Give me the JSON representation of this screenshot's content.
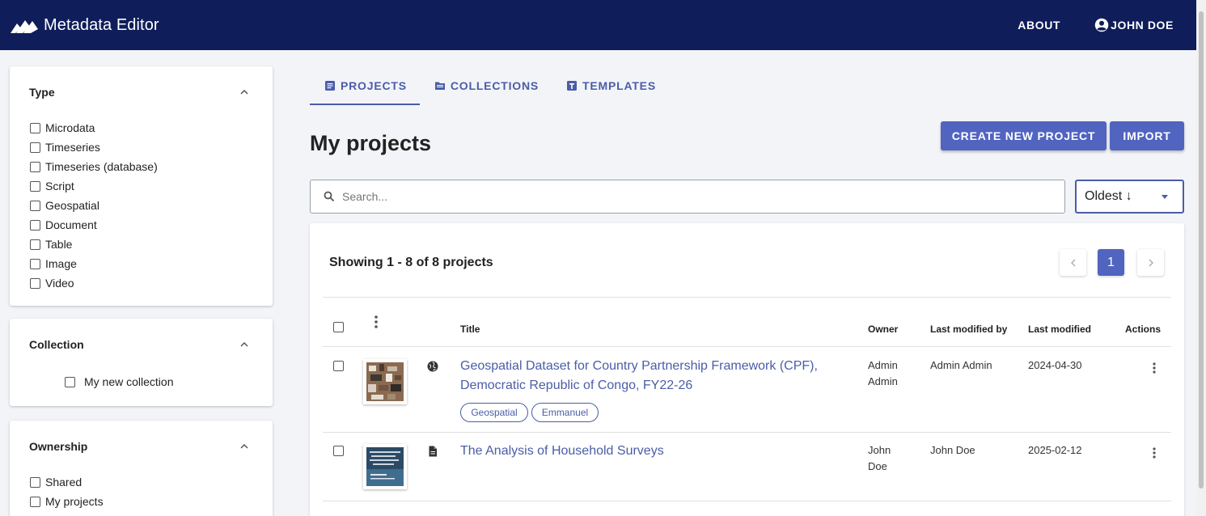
{
  "app": {
    "title": "Metadata Editor"
  },
  "header": {
    "about": "ABOUT",
    "user": "JOHN DOE"
  },
  "filters": {
    "type": {
      "title": "Type",
      "options": [
        "Microdata",
        "Timeseries",
        "Timeseries (database)",
        "Script",
        "Geospatial",
        "Document",
        "Table",
        "Image",
        "Video"
      ]
    },
    "collection": {
      "title": "Collection",
      "options": [
        "My new collection"
      ]
    },
    "ownership": {
      "title": "Ownership",
      "options": [
        "Shared",
        "My projects"
      ]
    }
  },
  "tabs": [
    {
      "label": "PROJECTS",
      "icon": "projects-icon",
      "active": true
    },
    {
      "label": "COLLECTIONS",
      "icon": "folder-icon",
      "active": false
    },
    {
      "label": "TEMPLATES",
      "icon": "template-icon",
      "active": false
    }
  ],
  "main": {
    "title": "My projects",
    "create_button": "CREATE NEW PROJECT",
    "import_button": "IMPORT",
    "search_placeholder": "Search...",
    "sort_value": "Oldest ↓",
    "showing": "Showing 1 - 8 of 8 projects",
    "current_page": "1"
  },
  "table": {
    "headers": {
      "title": "Title",
      "owner": "Owner",
      "modified_by": "Last modified by",
      "modified": "Last modified",
      "actions": "Actions"
    },
    "rows": [
      {
        "type_icon": "globe-icon",
        "title": "Geospatial Dataset for Country Partnership Framework (CPF), Democratic Republic of Congo, FY22-26",
        "owner": "Admin Admin",
        "modified_by": "Admin Admin",
        "modified": "2024-04-30",
        "tags": [
          "Geospatial",
          "Emmanuel"
        ]
      },
      {
        "type_icon": "document-icon",
        "title": "The Analysis of Household Surveys",
        "owner": "John Doe",
        "modified_by": "John Doe",
        "modified": "2025-02-12",
        "tags": []
      }
    ]
  },
  "colors": {
    "navy": "#0f1d5a",
    "accent": "#4a5da8",
    "button": "#5064c0"
  }
}
